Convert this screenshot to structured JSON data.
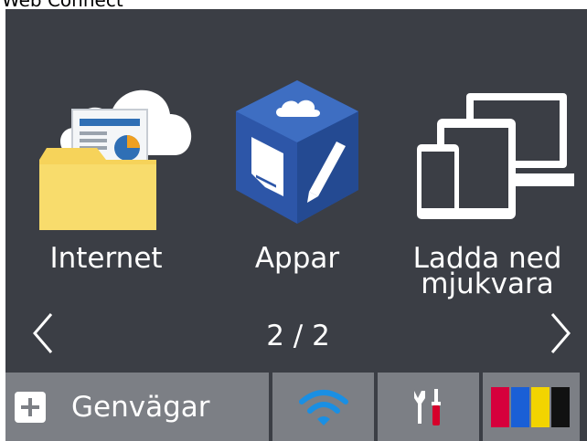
{
  "window": {
    "title_partial": "Web Connect"
  },
  "tiles": [
    {
      "label": "Internet",
      "icon": "cloud-folder-icon"
    },
    {
      "label": "Appar",
      "icon": "app-cube-icon"
    },
    {
      "label_line1": "Ladda ned",
      "label_line2": "mjukvara",
      "icon": "devices-icon"
    }
  ],
  "pager": {
    "text": "2 / 2"
  },
  "bottom_bar": {
    "shortcuts_label": "Genvägar",
    "wifi_icon": "wifi-icon",
    "tools_icon": "tools-icon",
    "ink_icon": "ink-levels-icon"
  },
  "colors": {
    "screen_bg": "#3b3e45",
    "button_bg": "#7c7f85",
    "wifi": "#1a8fe3",
    "ink_black": "#111111",
    "ink_cyan": "#1a5fd6",
    "ink_magenta": "#d6003c",
    "ink_yellow": "#f2d400"
  }
}
